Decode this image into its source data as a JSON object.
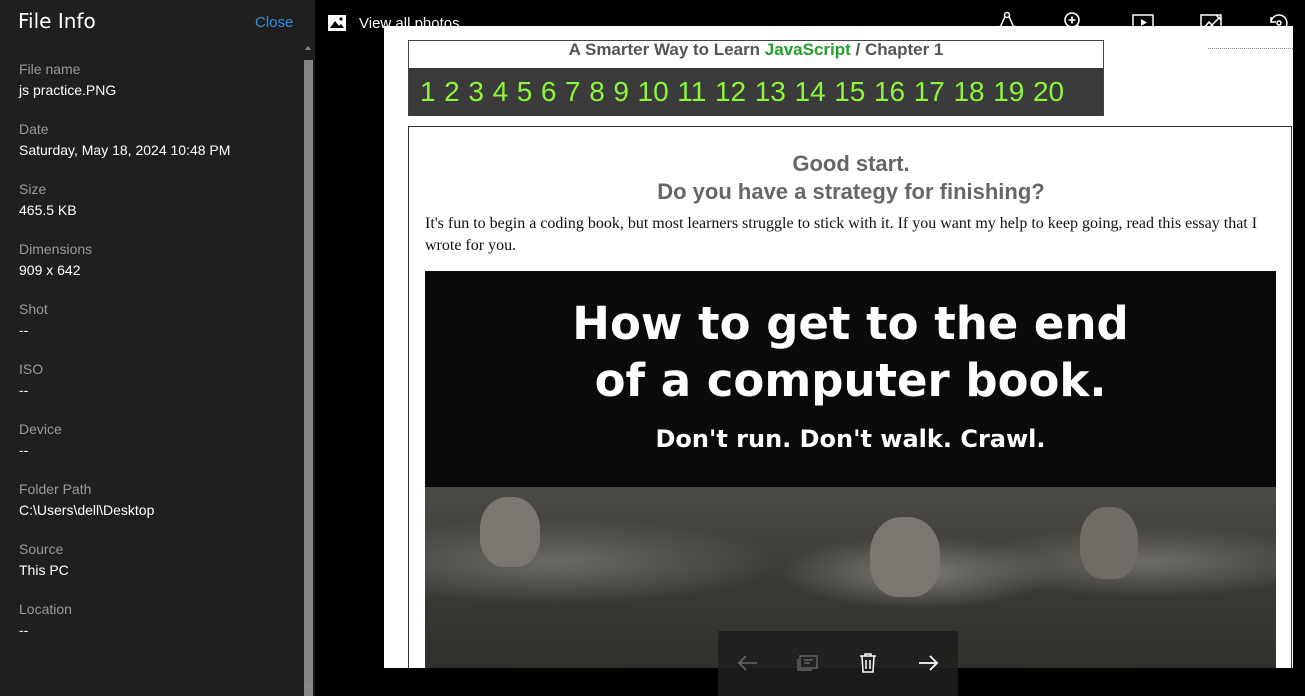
{
  "panel": {
    "title": "File Info",
    "close_label": "Close",
    "fields": [
      {
        "label": "File name",
        "value": "js practice.PNG"
      },
      {
        "label": "Date",
        "value": "Saturday, May 18, 2024 10:48 PM"
      },
      {
        "label": "Size",
        "value": "465.5 KB"
      },
      {
        "label": "Dimensions",
        "value": "909 x 642"
      },
      {
        "label": "Shot",
        "value": "--"
      },
      {
        "label": "ISO",
        "value": "--"
      },
      {
        "label": "Device",
        "value": "--"
      },
      {
        "label": "Folder Path",
        "value": "C:\\Users\\dell\\Desktop"
      },
      {
        "label": "Source",
        "value": "This PC"
      },
      {
        "label": "Location",
        "value": "--"
      }
    ]
  },
  "toolbar": {
    "view_all_label": "View all photos",
    "icons": [
      "share-icon",
      "zoom-in-icon",
      "slideshow-icon",
      "edit-image-icon",
      "rotate-icon"
    ]
  },
  "photo": {
    "chapter_prefix": "A Smarter Way to Learn ",
    "chapter_js": "JavaScript",
    "chapter_suffix": "  /  Chapter 1",
    "numbers": [
      "1",
      "2",
      "3",
      "4",
      "5",
      "6",
      "7",
      "8",
      "9",
      "10",
      "11",
      "12",
      "13",
      "14",
      "15",
      "16",
      "17",
      "18",
      "19",
      "20"
    ],
    "heading1": "Good start.",
    "heading2": "Do you have a strategy for finishing?",
    "paragraph": "It's fun to begin a coding book, but most learners struggle to stick with it. If you want my help to keep going, read this essay that I wrote for you.",
    "banner_line1": "How to get to the end",
    "banner_line2": "of a computer book.",
    "banner_sub": "Don't run. Don't walk. Crawl."
  },
  "bottom_bar": {
    "icons": [
      "back-arrow-icon",
      "add-to-album-icon",
      "delete-icon",
      "forward-arrow-icon"
    ]
  },
  "colors": {
    "panel_bg": "#1f1f1f",
    "accent_link": "#2f8fe0",
    "number_green": "#8ef53d",
    "javascript_green": "#22a02a"
  }
}
